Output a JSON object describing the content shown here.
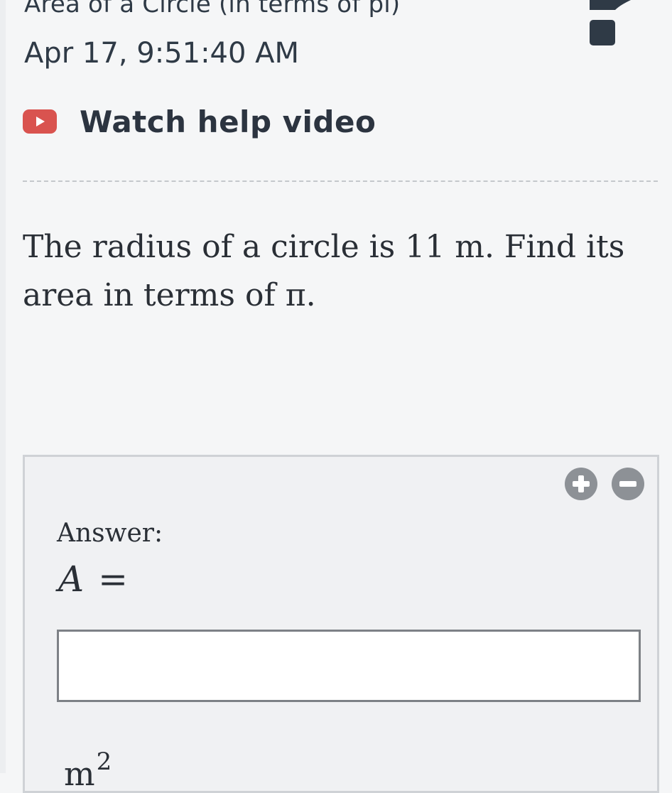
{
  "header": {
    "title": "Area of a Circle (in terms of pi)",
    "date": "Apr 17, 9:51:40 AM"
  },
  "help": {
    "label": "Watch help video",
    "icon": "play-video-icon"
  },
  "flag": {
    "icon": "flag-icon"
  },
  "question": {
    "part1": "The radius of a circle is ",
    "number": "11",
    "part2": " m. Find its area in terms of ",
    "pi": "π",
    "part3": "."
  },
  "answer": {
    "label": "Answer:",
    "variable": "A",
    "equals": "=",
    "input_value": "",
    "input_placeholder": "",
    "unit_base": "m",
    "unit_exponent": "2"
  },
  "zoom": {
    "plus_icon": "zoom-in-icon",
    "minus_icon": "zoom-out-icon"
  },
  "colors": {
    "play_red": "#d9534f",
    "flag_dark": "#2f3a46",
    "zoom_gray": "#8d9196",
    "background": "#f5f6f7",
    "answer_panel": "#f0f1f3",
    "text": "#2c3440"
  }
}
